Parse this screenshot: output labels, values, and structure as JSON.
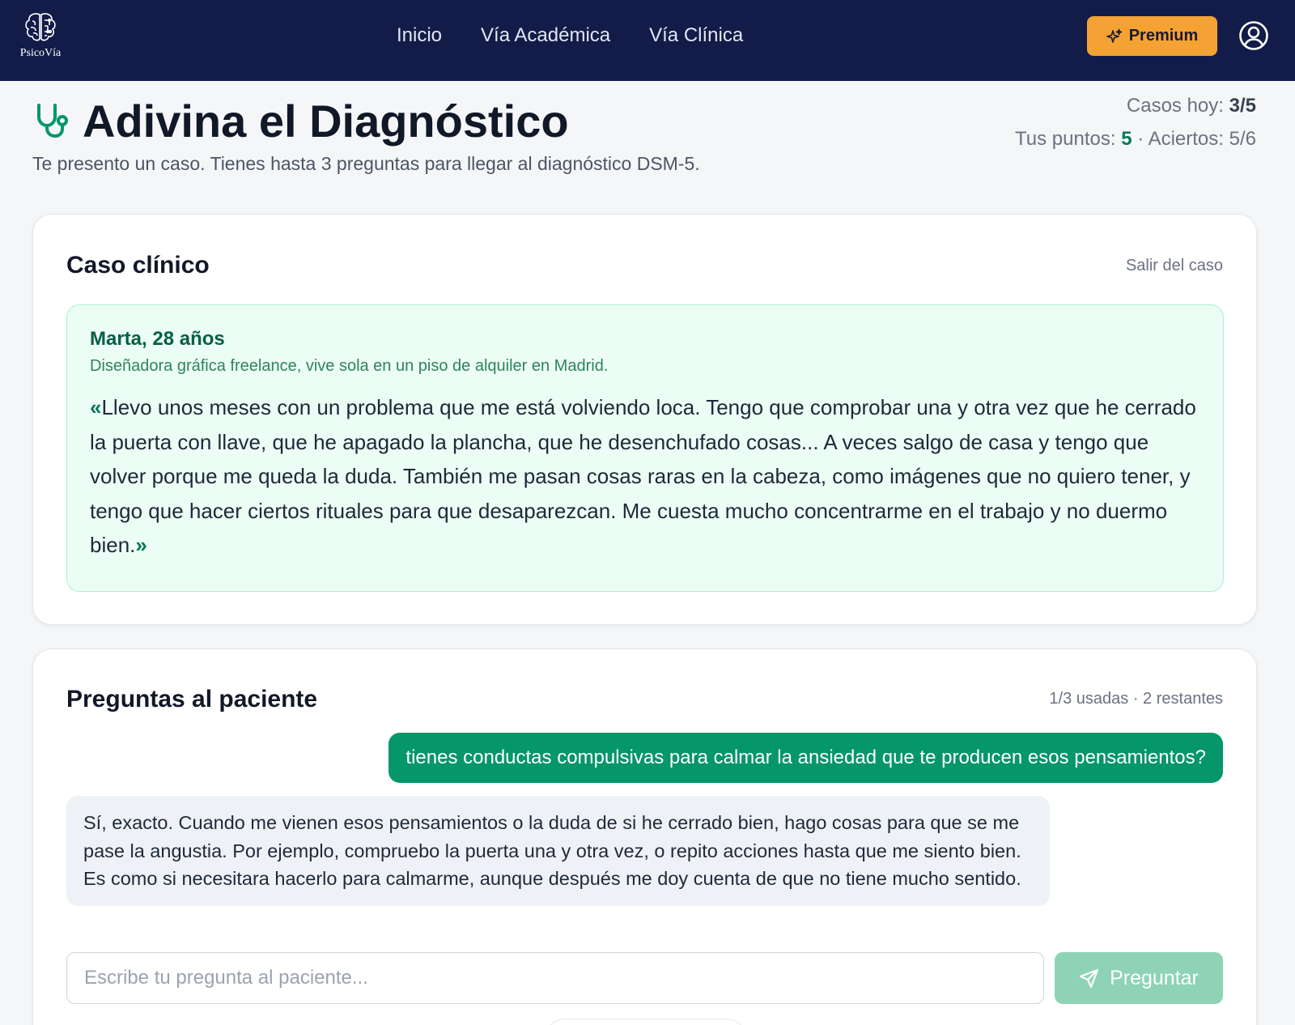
{
  "navbar": {
    "logo_text": "PsicoVía",
    "links": [
      "Inicio",
      "Vía Académica",
      "Vía Clínica"
    ],
    "premium_label": "Premium"
  },
  "header": {
    "title": "Adivina el Diagnóstico",
    "subtitle": "Te presento un caso. Tienes hasta 3 preguntas para llegar al diagnóstico DSM-5.",
    "cases_label": "Casos hoy:",
    "cases_value": "3/5",
    "points_label": "Tus puntos:",
    "points_value": "5",
    "separator": " · ",
    "hits_label": "Aciertos:",
    "hits_value": "5/6"
  },
  "case": {
    "heading": "Caso clínico",
    "exit_label": "Salir del caso",
    "patient_name": "Marta, 28 años",
    "patient_desc": "Diseñadora gráfica freelance, vive sola en un piso de alquiler en Madrid.",
    "quote_open": "«",
    "quote": "Llevo unos meses con un problema que me está volviendo loca. Tengo que comprobar una y otra vez que he cerrado la puerta con llave, que he apagado la plancha, que he desenchufado cosas... A veces salgo de casa y tengo que volver porque me queda la duda. También me pasan cosas raras en la cabeza, como imágenes que no quiero tener, y tengo que hacer ciertos rituales para que desaparezcan. Me cuesta mucho concentrarme en el trabajo y no duermo bien.",
    "quote_close": "»"
  },
  "questions": {
    "heading": "Preguntas al paciente",
    "counter": "1/3 usadas · 2 restantes",
    "user_message": "tienes conductas compulsivas para calmar la ansiedad que te producen esos pensamientos?",
    "patient_reply": "Sí, exacto. Cuando me vienen esos pensamientos o la duda de si he cerrado bien, hago cosas para que se me pase la angustia. Por ejemplo, compruebo la puerta una y otra vez, o repito acciones hasta que me siento bien. Es como si necesitara hacerlo para calmarme, aunque después me doy cuenta de que no tiene mucho sentido.",
    "input_placeholder": "Escribe tu pregunta al paciente...",
    "input_value": "",
    "ask_label": "Preguntar"
  },
  "colors": {
    "navbar": "#131c48",
    "accent_green": "#059669",
    "premium": "#f4a234"
  },
  "icons": [
    "brain-icon",
    "sparkles-icon",
    "user-circle-icon",
    "stethoscope-icon",
    "send-icon"
  ]
}
